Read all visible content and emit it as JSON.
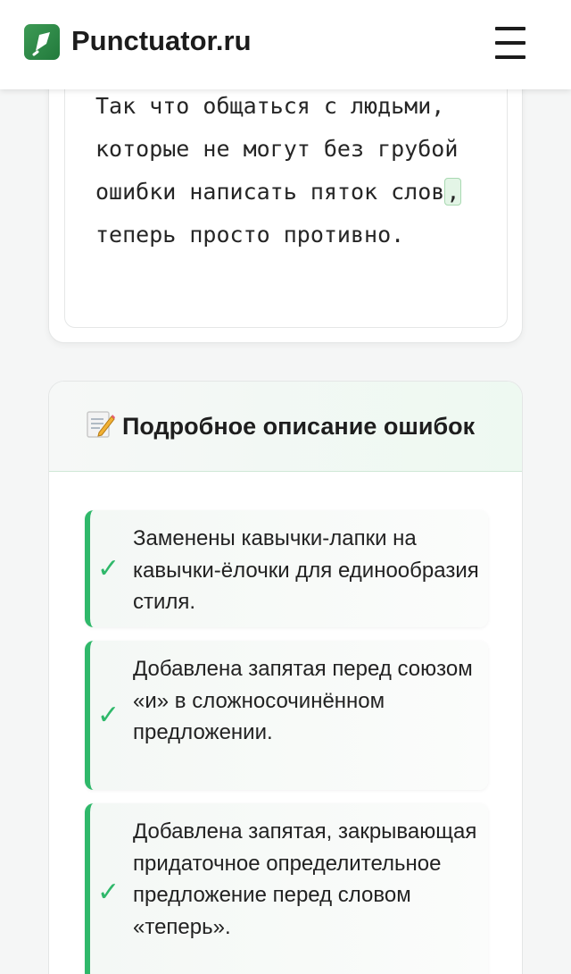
{
  "header": {
    "brand": "Punctuator.ru",
    "logo_icon": "quill-leaf-icon",
    "menu_icon": "hamburger-menu-icon"
  },
  "corrected": {
    "before_comma": "Так что общаться с людьми, которые не могут без грубой ошибки написать пяток слов",
    "comma": ",",
    "after_comma": " теперь просто противно."
  },
  "errors": {
    "title": "Подробное описание ошибок",
    "title_icon": "memo-icon",
    "items": [
      {
        "text": "Заменены кавычки-лапки на кавычки-ёлочки для единообразия стиля.",
        "icon": "check-icon"
      },
      {
        "text": "Добавлена запятая перед союзом «и» в сложносочинённом предложении.",
        "icon": "check-icon"
      },
      {
        "text": "Добавлена запятая, закрывающая придаточное определительное предложение перед словом «теперь».",
        "icon": "check-icon"
      }
    ]
  },
  "colors": {
    "accent_green": "#2fb86a",
    "logo_green": "#2f8a48",
    "highlight_bg": "#e3f5e6"
  }
}
